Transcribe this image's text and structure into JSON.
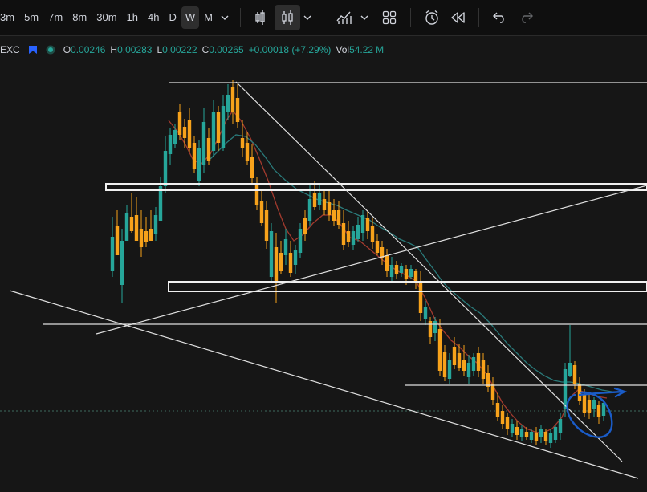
{
  "toolbar": {
    "timeframes": [
      "3m",
      "5m",
      "7m",
      "8m",
      "30m",
      "1h",
      "4h",
      "D",
      "W",
      "M"
    ],
    "active_timeframe": "W",
    "icons": [
      "chevron-down-icon",
      "bar-style-icon",
      "candlestick-icon",
      "chevron-down-icon",
      "indicators-icon",
      "chevron-down-icon",
      "layout-grid-icon",
      "alert-clock-icon",
      "replay-icon",
      "undo-icon",
      "redo-icon"
    ]
  },
  "legend": {
    "symbol": "EXC",
    "open_label": "O",
    "open": "0.00246",
    "high_label": "H",
    "high": "0.00283",
    "low_label": "L",
    "low": "0.00222",
    "close_label": "C",
    "close": "0.00265",
    "change": "+0.00018 (+7.29%)",
    "volume_label": "Vol",
    "volume": "54.22",
    "volume_unit": "M"
  },
  "colors": {
    "background": "#161616",
    "up": "#26a69a",
    "down": "#f7a21b",
    "ma_fast": "#a33a2e",
    "ma_slow": "#2a7a7a",
    "lines": "#e0e0e0",
    "annotation": "#1565c0"
  }
}
